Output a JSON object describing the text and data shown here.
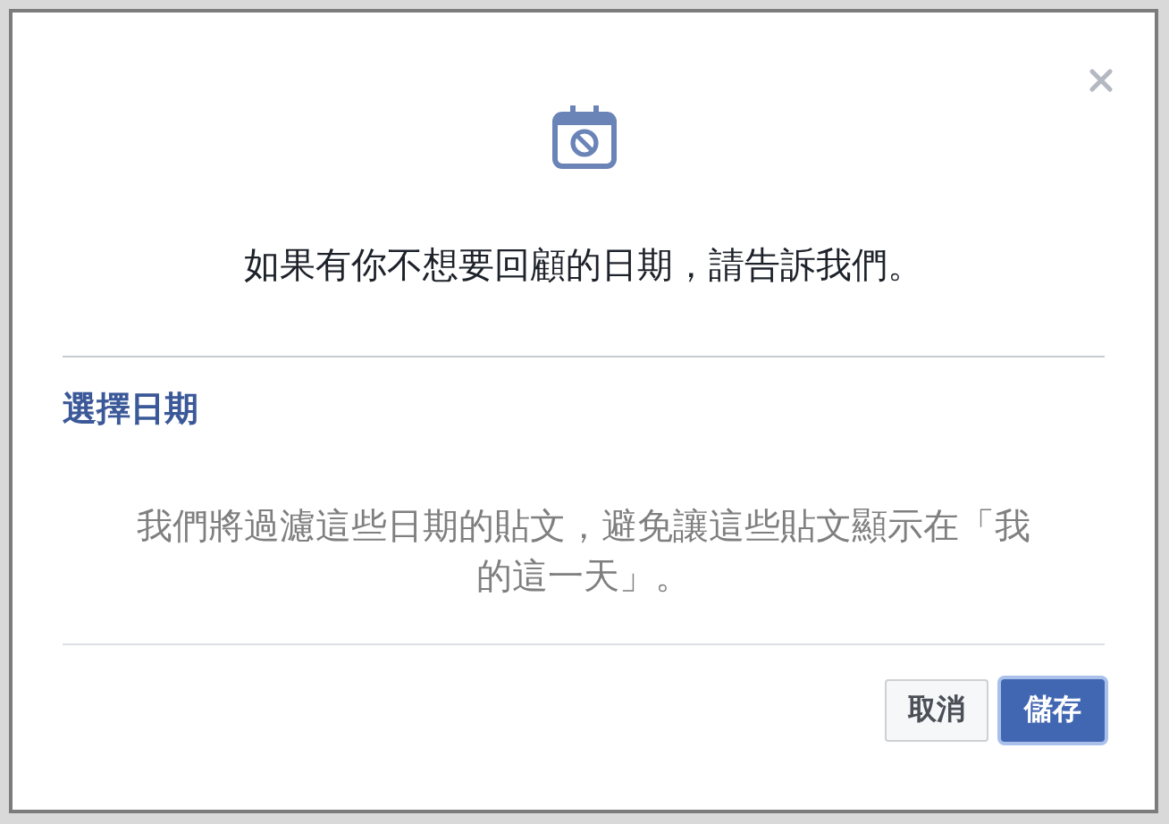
{
  "dialog": {
    "message": "如果有你不想要回顧的日期，請告訴我們。",
    "section_title": "選擇日期",
    "description": "我們將過濾這些日期的貼文，避免讓這些貼文顯示在「我的這一天」。",
    "buttons": [
      {
        "label": "取消",
        "kind": "secondary"
      },
      {
        "label": "儲存",
        "kind": "primary"
      }
    ]
  }
}
